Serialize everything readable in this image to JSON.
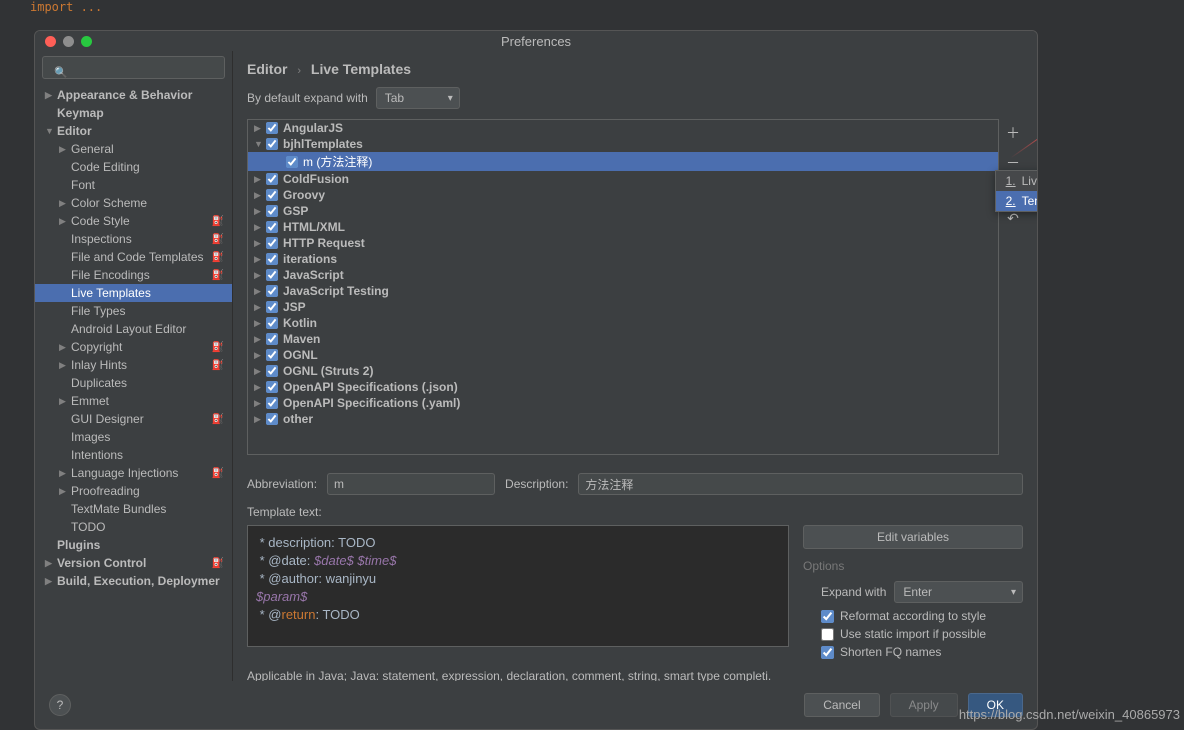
{
  "editor_bg": {
    "import": "import ..."
  },
  "dialog": {
    "title": "Preferences",
    "search_placeholder": "",
    "breadcrumb": {
      "parent": "Editor",
      "current": "Live Templates"
    },
    "expand_label": "By default expand with",
    "expand_value": "Tab",
    "sidebar": [
      {
        "label": "Appearance & Behavior",
        "bold": true,
        "arrow": true,
        "indent": 0
      },
      {
        "label": "Keymap",
        "bold": true,
        "indent": 0
      },
      {
        "label": "Editor",
        "bold": true,
        "arrow": true,
        "open": true,
        "indent": 0
      },
      {
        "label": "General",
        "arrow": true,
        "indent": 1
      },
      {
        "label": "Code Editing",
        "indent": 1
      },
      {
        "label": "Font",
        "indent": 1
      },
      {
        "label": "Color Scheme",
        "arrow": true,
        "indent": 1
      },
      {
        "label": "Code Style",
        "arrow": true,
        "indent": 1,
        "gear": true
      },
      {
        "label": "Inspections",
        "indent": 1,
        "gear": true
      },
      {
        "label": "File and Code Templates",
        "indent": 1,
        "gear": true
      },
      {
        "label": "File Encodings",
        "indent": 1,
        "gear": true
      },
      {
        "label": "Live Templates",
        "indent": 1,
        "selected": true
      },
      {
        "label": "File Types",
        "indent": 1
      },
      {
        "label": "Android Layout Editor",
        "indent": 1
      },
      {
        "label": "Copyright",
        "arrow": true,
        "indent": 1,
        "gear": true
      },
      {
        "label": "Inlay Hints",
        "arrow": true,
        "indent": 1,
        "gear": true
      },
      {
        "label": "Duplicates",
        "indent": 1
      },
      {
        "label": "Emmet",
        "arrow": true,
        "indent": 1
      },
      {
        "label": "GUI Designer",
        "indent": 1,
        "gear": true
      },
      {
        "label": "Images",
        "indent": 1
      },
      {
        "label": "Intentions",
        "indent": 1
      },
      {
        "label": "Language Injections",
        "arrow": true,
        "indent": 1,
        "gear": true
      },
      {
        "label": "Proofreading",
        "arrow": true,
        "indent": 1
      },
      {
        "label": "TextMate Bundles",
        "indent": 1
      },
      {
        "label": "TODO",
        "indent": 1
      },
      {
        "label": "Plugins",
        "bold": true,
        "indent": 0
      },
      {
        "label": "Version Control",
        "bold": true,
        "arrow": true,
        "indent": 0,
        "gear": true
      },
      {
        "label": "Build, Execution, Deploymer",
        "bold": true,
        "arrow": true,
        "indent": 0
      }
    ],
    "templates": [
      {
        "label": "AngularJS",
        "arrow": true
      },
      {
        "label": "bjhlTemplates",
        "arrow": true,
        "open": true,
        "children": [
          {
            "label": "m (方法注释)",
            "selected": true
          }
        ]
      },
      {
        "label": "ColdFusion",
        "arrow": true
      },
      {
        "label": "Groovy",
        "arrow": true
      },
      {
        "label": "GSP",
        "arrow": true
      },
      {
        "label": "HTML/XML",
        "arrow": true
      },
      {
        "label": "HTTP Request",
        "arrow": true
      },
      {
        "label": "iterations",
        "arrow": true
      },
      {
        "label": "JavaScript",
        "arrow": true
      },
      {
        "label": "JavaScript Testing",
        "arrow": true
      },
      {
        "label": "JSP",
        "arrow": true
      },
      {
        "label": "Kotlin",
        "arrow": true
      },
      {
        "label": "Maven",
        "arrow": true
      },
      {
        "label": "OGNL",
        "arrow": true
      },
      {
        "label": "OGNL (Struts 2)",
        "arrow": true
      },
      {
        "label": "OpenAPI Specifications (.json)",
        "arrow": true
      },
      {
        "label": "OpenAPI Specifications (.yaml)",
        "arrow": true
      },
      {
        "label": "other",
        "arrow": true
      }
    ],
    "popup": {
      "item1_num": "1.",
      "item1": "Live Template",
      "item2_num": "2.",
      "item2": "Template Group..."
    },
    "abbr_label": "Abbreviation:",
    "abbr_value": "m",
    "desc_label": "Description:",
    "desc_value": "方法注释",
    "template_text_label": "Template text:",
    "edit_vars": "Edit variables",
    "options_label": "Options",
    "expand_with_label": "Expand with",
    "expand_with_value": "Enter",
    "opt1": "Reformat according to style",
    "opt2": "Use static import if possible",
    "opt3": "Shorten FQ names",
    "code": {
      "l1a": " * description: TODO",
      "l2a": " * @date: ",
      "l2b": "$date$",
      "l2c": " ",
      "l2d": "$time$",
      "l3a": " * @author: wanjinyu",
      "l4a": "$param$",
      "l5a": " * @",
      "l5b": "return",
      "l5c": ": TODO"
    },
    "applicable": "Applicable in Java; Java: statement, expression, declaration, comment, string, smart type completi.",
    "footer": {
      "help": "?",
      "cancel": "Cancel",
      "apply": "Apply",
      "ok": "OK"
    }
  },
  "watermark": "https://blog.csdn.net/weixin_40865973"
}
